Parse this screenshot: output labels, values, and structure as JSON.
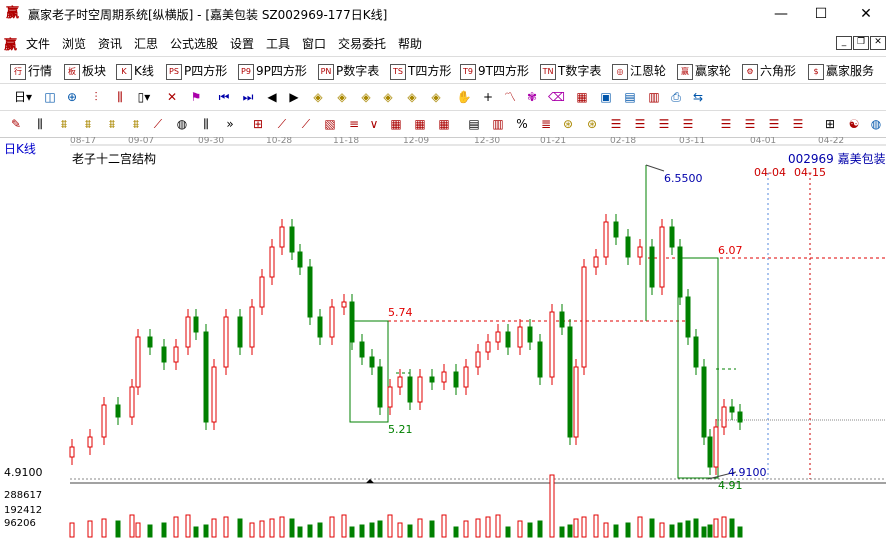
{
  "window": {
    "title": "赢家老子时空周期系统[纵横版] - [嘉美包装  SZ002969-177日K线]",
    "logo_char": "赢"
  },
  "menu": {
    "items": [
      "文件",
      "浏览",
      "资讯",
      "汇思",
      "公式选股",
      "设置",
      "工具",
      "窗口",
      "交易委托",
      "帮助"
    ]
  },
  "toolbar1": {
    "items": [
      {
        "icon": "行",
        "label": "行情"
      },
      {
        "icon": "板",
        "label": "板块"
      },
      {
        "icon": "K",
        "label": "K线"
      },
      {
        "icon": "PS",
        "label": "P四方形"
      },
      {
        "icon": "P9",
        "label": "9P四方形"
      },
      {
        "icon": "PN",
        "label": "P数字表"
      },
      {
        "icon": "TS",
        "label": "T四方形"
      },
      {
        "icon": "T9",
        "label": "9T四方形"
      },
      {
        "icon": "TN",
        "label": "T数字表"
      },
      {
        "icon": "◎",
        "label": "江恩轮"
      },
      {
        "icon": "赢",
        "label": "赢家轮"
      },
      {
        "icon": "⚙",
        "label": "六角形"
      },
      {
        "icon": "$",
        "label": "赢家服务"
      }
    ]
  },
  "chart": {
    "period_label": "日K线",
    "title": "老子十二宫结构",
    "stock_label": "002969  嘉美包装",
    "date_ticks": [
      "08-17",
      "09-07",
      "09-30",
      "10-28",
      "11-18",
      "12-09",
      "12-30",
      "01-21",
      "02-18",
      "03-11",
      "04-01",
      "04-22"
    ],
    "future_dates": [
      "04-04",
      "04-15"
    ],
    "price_labels": {
      "high": "6.5500",
      "level_607": "6.07",
      "level_574": "5.74",
      "level_521": "5.21",
      "low": "4.9100",
      "low_green": "4.91",
      "axis_low": "4.9100"
    },
    "volume_labels": [
      "288617",
      "192412",
      "96206"
    ],
    "colors": {
      "up": "#e00000",
      "down": "#008000",
      "guide_red": "#e00000",
      "box_green": "#008000",
      "future_line": "#cc0000",
      "blue_text": "#0000aa"
    }
  }
}
